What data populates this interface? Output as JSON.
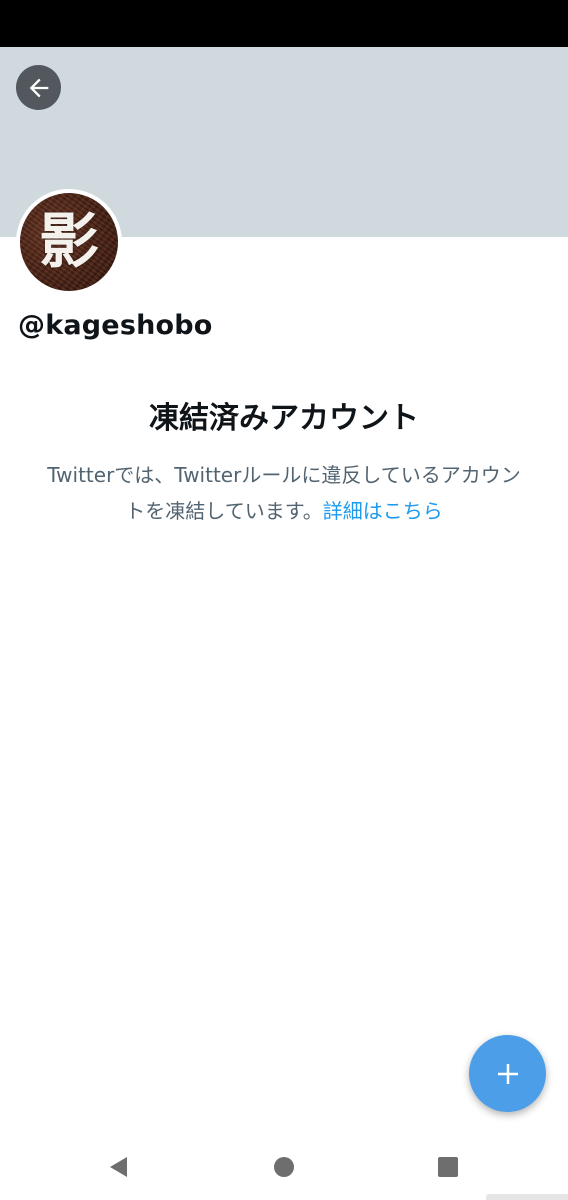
{
  "profile": {
    "handle": "@kageshobo",
    "avatar_glyph": "影",
    "banner_color": "#cfd9de"
  },
  "suspended": {
    "title": "凍結済みアカウント",
    "description": "Twitterでは、Twitterルールに違反しているアカウントを凍結しています。",
    "learn_more": "詳細はこちら"
  },
  "icons": {
    "back": "arrow-left-icon",
    "compose": "plus-icon",
    "nav_back": "triangle-back-icon",
    "nav_home": "circle-home-icon",
    "nav_recents": "square-recents-icon"
  },
  "colors": {
    "accent": "#1d9bf0",
    "fab": "#4c9ee8",
    "text_primary": "#0f1419",
    "text_secondary": "#536471"
  }
}
